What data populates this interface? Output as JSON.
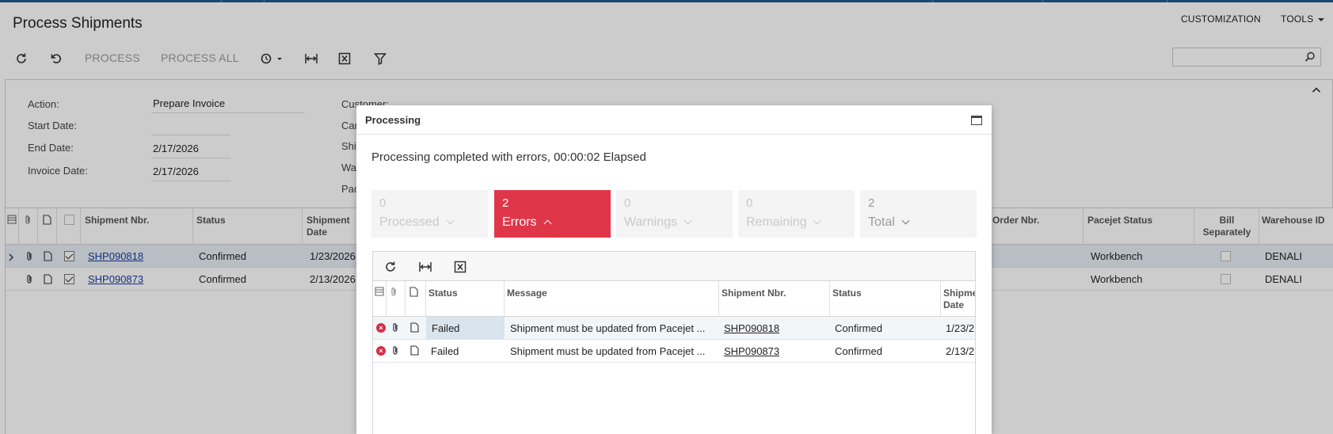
{
  "app": {
    "title": "Process Shipments"
  },
  "top_menu": {
    "customization": "CUSTOMIZATION",
    "tools": "TOOLS"
  },
  "toolbar": {
    "refresh_icon": "refresh-icon",
    "undo_icon": "undo-icon",
    "process_label": "PROCESS",
    "process_all_label": "PROCESS ALL",
    "schedule_icon": "schedule-icon",
    "fit_icon": "fit-to-screen-icon",
    "excel_icon": "export-excel-icon",
    "filter_icon": "filter-icon",
    "search_placeholder": ""
  },
  "form": {
    "action_label": "Action:",
    "action_value": "Prepare Invoice",
    "start_date_label": "Start Date:",
    "start_date_value": "",
    "end_date_label": "End Date:",
    "end_date_value": "2/17/2026",
    "invoice_date_label": "Invoice Date:",
    "invoice_date_value": "2/17/2026",
    "customer_label": "Customer:",
    "partial_labels": [
      "Car",
      "Shi",
      "Wa",
      "Pac"
    ]
  },
  "grid": {
    "headers": {
      "shipment_nbr": "Shipment Nbr.",
      "status": "Status",
      "shipment_date_1": "Shipment",
      "shipment_date_2": "Date",
      "order_nbr": "Order Nbr.",
      "pacejet_status": "Pacejet Status",
      "bill_1": "Bill",
      "bill_2": "Separately",
      "warehouse": "Warehouse ID"
    },
    "rows": [
      {
        "shipment_nbr": "SHP090818",
        "status": "Confirmed",
        "date": "1/23/2026",
        "pacejet_status": "Workbench",
        "bill_separately": false,
        "warehouse": "DENALI",
        "selected": true
      },
      {
        "shipment_nbr": "SHP090873",
        "status": "Confirmed",
        "date": "2/13/2026",
        "pacejet_status": "Workbench",
        "bill_separately": false,
        "warehouse": "DENALI",
        "selected": true
      }
    ]
  },
  "dialog": {
    "title": "Processing",
    "message": "Processing completed with errors, 00:00:02 Elapsed",
    "tiles": {
      "processed": {
        "count": "0",
        "label": "Processed"
      },
      "errors": {
        "count": "2",
        "label": "Errors",
        "color": "#e0364a"
      },
      "warnings": {
        "count": "0",
        "label": "Warnings"
      },
      "remaining": {
        "count": "0",
        "label": "Remaining"
      },
      "total": {
        "count": "2",
        "label": "Total"
      }
    },
    "grid": {
      "headers": {
        "status": "Status",
        "message": "Message",
        "shipment_nbr": "Shipment Nbr.",
        "status2": "Status",
        "shipment_date_1": "Shipme",
        "shipment_date_2": "Date"
      },
      "rows": [
        {
          "status": "Failed",
          "message": "Shipment must be updated from Pacejet ...",
          "shipment_nbr": "SHP090818",
          "status2": "Confirmed",
          "date": "1/23/2"
        },
        {
          "status": "Failed",
          "message": "Shipment must be updated from Pacejet ...",
          "shipment_nbr": "SHP090873",
          "status2": "Confirmed",
          "date": "2/13/2"
        }
      ]
    }
  }
}
